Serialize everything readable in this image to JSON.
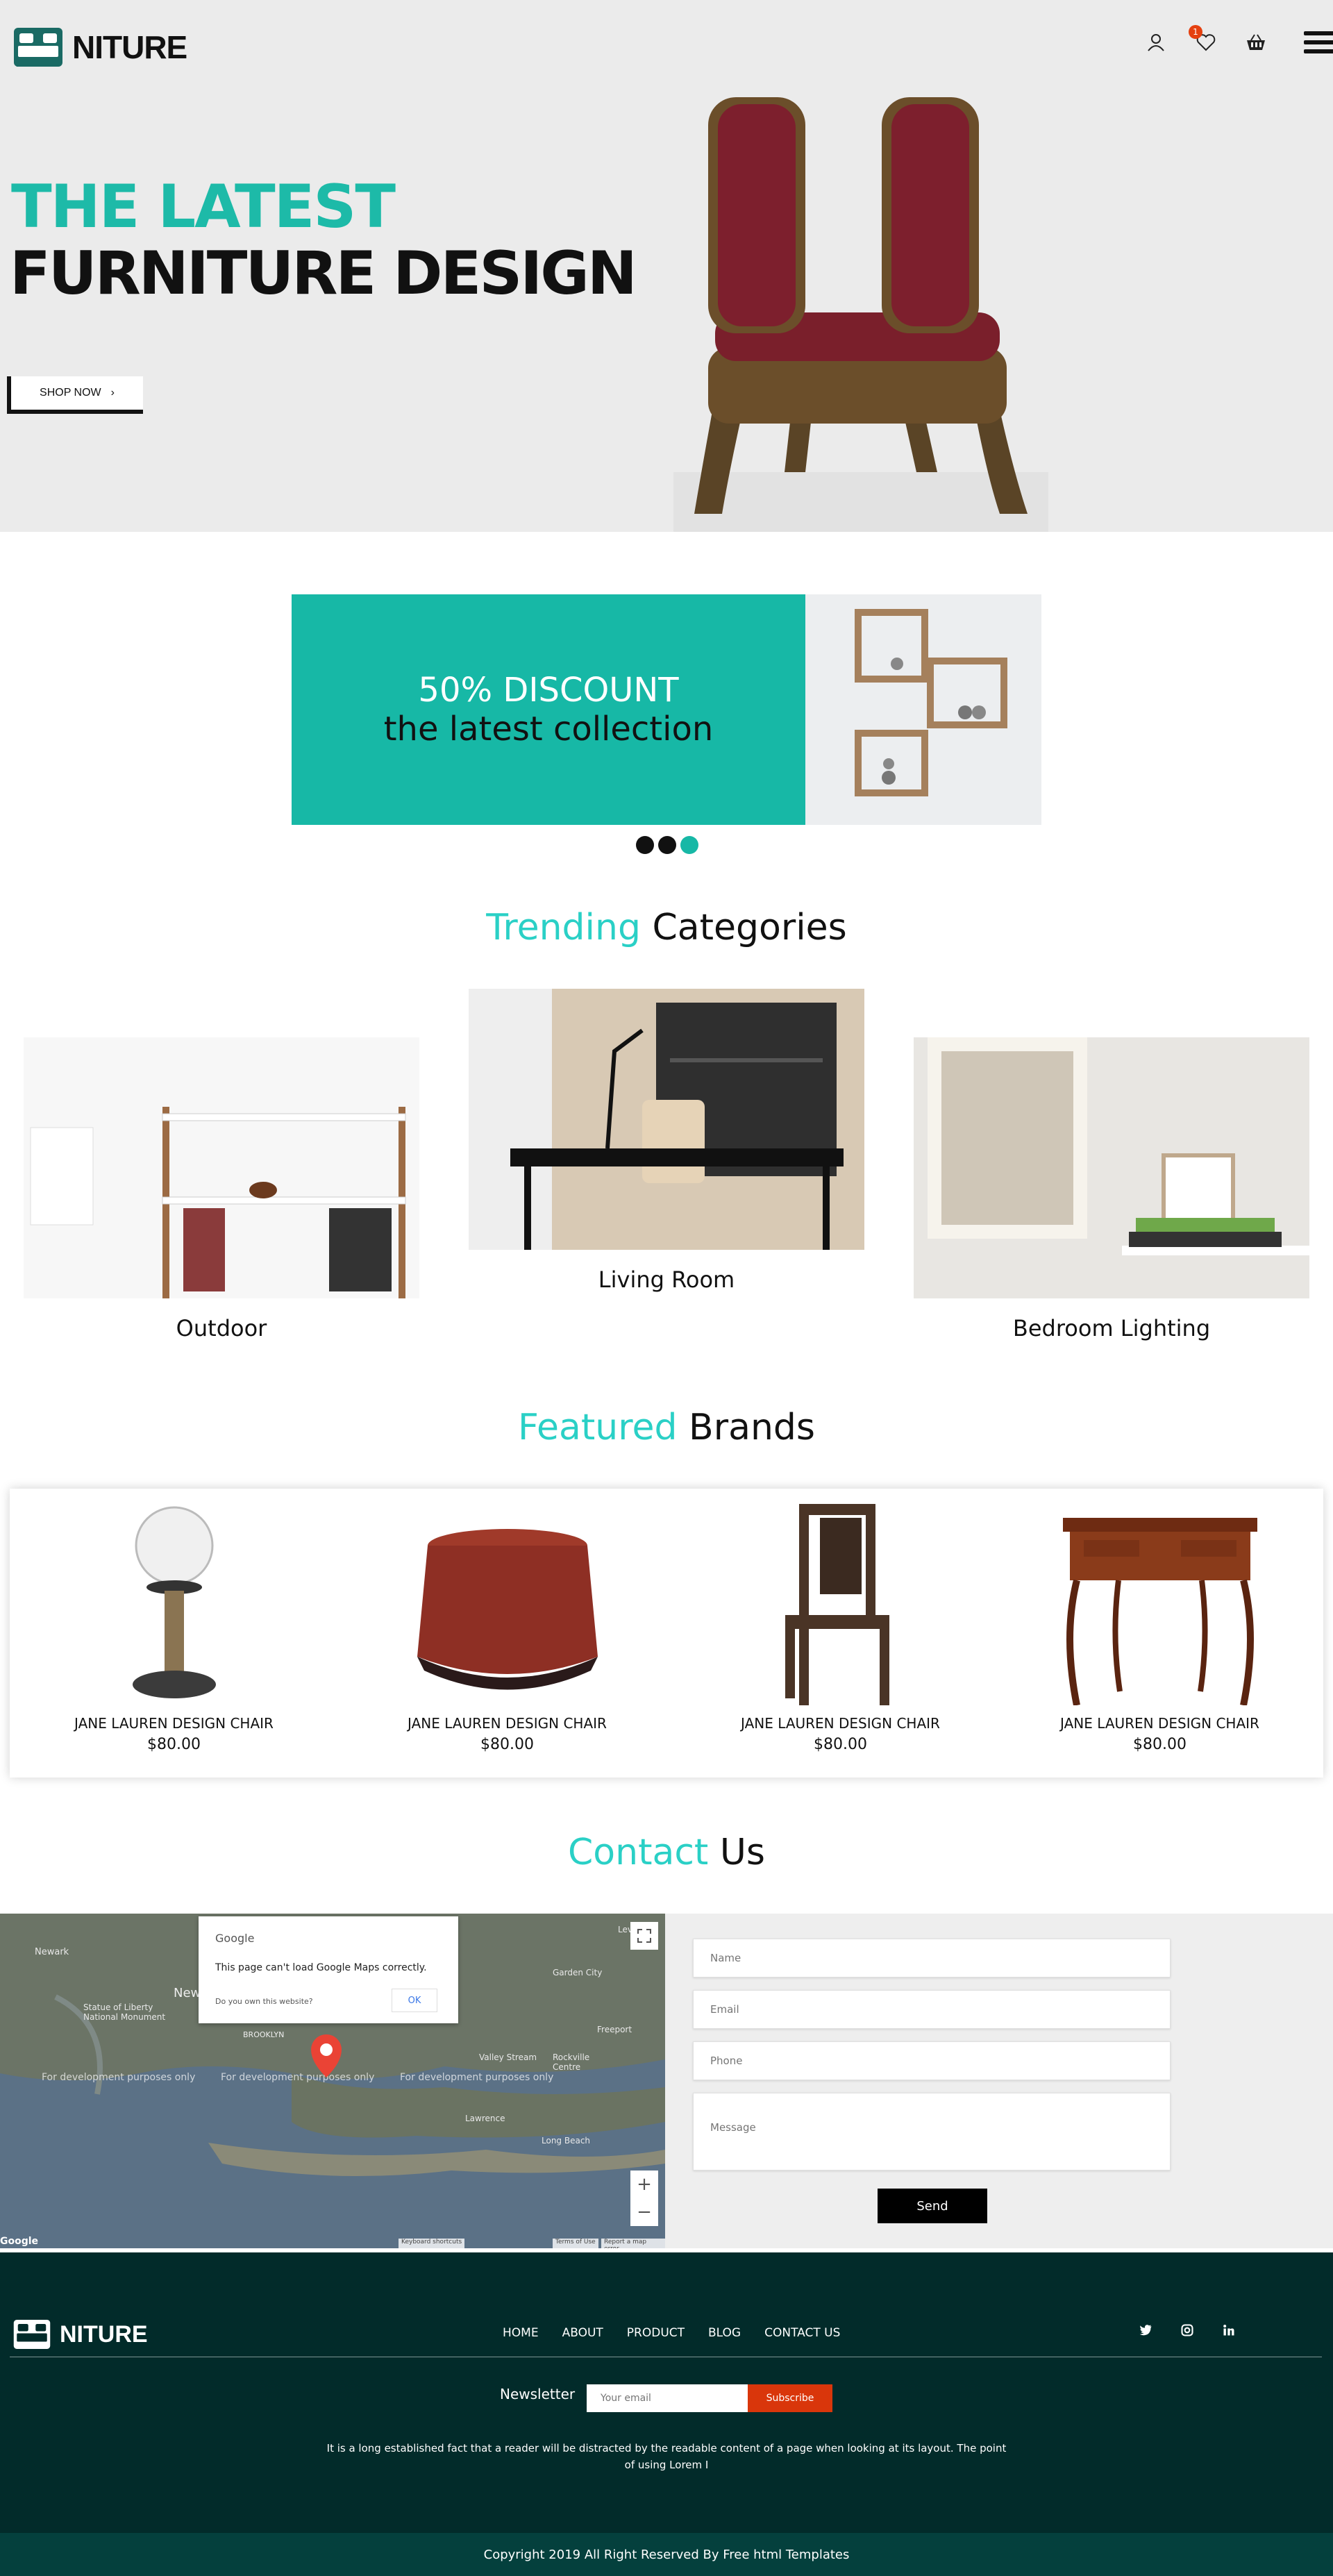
{
  "brand": {
    "name": "NITURE"
  },
  "header": {
    "cart_badge": "1",
    "icons": [
      "user-icon",
      "heart-icon",
      "basket-icon",
      "menu-icon"
    ]
  },
  "hero": {
    "title_accent": "THE LATEST",
    "title_main": "FURNITURE DESIGN",
    "cta_label": "SHOP NOW",
    "cta_arrow": "›"
  },
  "banner": {
    "line1": "50% DISCOUNT",
    "line2": "the latest collection",
    "slides": 3,
    "active_slide": 3
  },
  "categories": {
    "title_accent": "Trending",
    "title_rest": " Categories",
    "items": [
      {
        "label": "Outdoor"
      },
      {
        "label": "Living Room"
      },
      {
        "label": "Bedroom Lighting"
      }
    ]
  },
  "brands": {
    "title_accent": "Featured",
    "title_rest": " Brands",
    "products": [
      {
        "name": "JANE LAUREN DESIGN CHAIR",
        "price": "$80.00"
      },
      {
        "name": "JANE LAUREN DESIGN CHAIR",
        "price": "$80.00"
      },
      {
        "name": "JANE LAUREN DESIGN CHAIR",
        "price": "$80.00"
      },
      {
        "name": "JANE LAUREN DESIGN CHAIR",
        "price": "$80.00"
      }
    ]
  },
  "contact": {
    "title_accent": "Contact",
    "title_rest": " Us",
    "map": {
      "google_label": "Google",
      "error_message": "This page can't load Google Maps correctly.",
      "own_question": "Do you own this website?",
      "ok_label": "OK",
      "dev_notice": "For development purposes only",
      "zoom_in": "+",
      "zoom_out": "−",
      "attribution_shortcuts": "Keyboard shortcuts",
      "attribution_terms": "Terms of Use",
      "attribution_report": "Report a map error",
      "place_labels": [
        "Newark",
        "Statue of Liberty National Monument",
        "New",
        "BROOKLYN",
        "Garden City",
        "Valley Stream",
        "Rockville Centre",
        "Freeport",
        "Levittown",
        "Lawrence",
        "Long Beach"
      ]
    },
    "form": {
      "name_placeholder": "Name",
      "email_placeholder": "Email",
      "phone_placeholder": "Phone",
      "message_placeholder": "Message",
      "send_label": "Send"
    }
  },
  "footer": {
    "nav": [
      "HOME",
      "ABOUT",
      "PRODUCT",
      "BLOG",
      "CONTACT US"
    ],
    "social": [
      "twitter-icon",
      "instagram-icon",
      "linkedin-icon"
    ],
    "newsletter_label": "Newsletter",
    "newsletter_placeholder": "Your email",
    "subscribe_label": "Subscribe",
    "about_text": "It is a long established fact that a reader will be distracted by the readable content of a page when looking at its layout. The point of using Lorem I",
    "copyright": "Copyright 2019 All Right Reserved By Free html Templates"
  },
  "colors": {
    "accent_teal": "#17b8a6",
    "title_accent": "#2ad0c6",
    "subscribe_orange": "#d9360b",
    "footer_bg": "#022b2a"
  }
}
